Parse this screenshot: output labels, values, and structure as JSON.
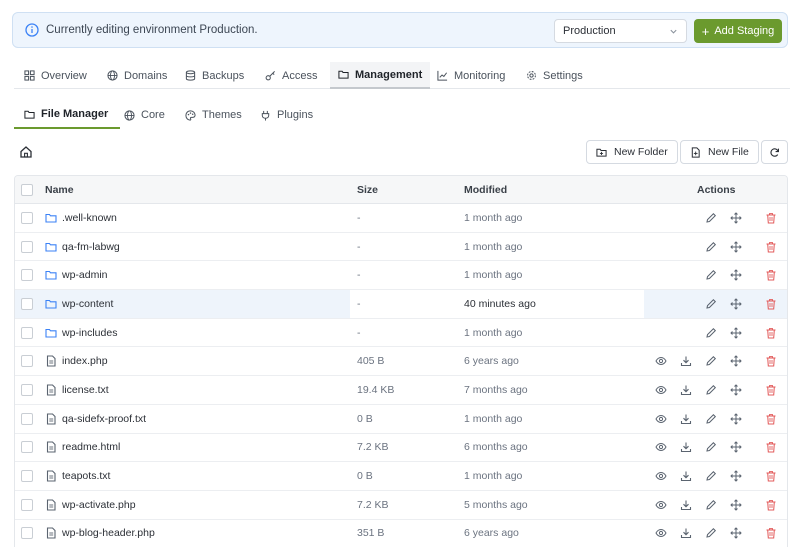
{
  "banner": {
    "text": "Currently editing environment Production.",
    "environment": "Production",
    "add_staging_label": "Add Staging"
  },
  "main_tabs": [
    {
      "label": "Overview",
      "icon": "grid-icon"
    },
    {
      "label": "Domains",
      "icon": "globe-icon"
    },
    {
      "label": "Backups",
      "icon": "database-icon"
    },
    {
      "label": "Access",
      "icon": "key-icon"
    },
    {
      "label": "Management",
      "icon": "folder-icon",
      "active": true
    },
    {
      "label": "Monitoring",
      "icon": "chart-icon"
    },
    {
      "label": "Settings",
      "icon": "gear-icon"
    }
  ],
  "sub_tabs": [
    {
      "label": "File Manager",
      "icon": "folder-icon",
      "active": true
    },
    {
      "label": "Core",
      "icon": "globe-icon"
    },
    {
      "label": "Themes",
      "icon": "palette-icon"
    },
    {
      "label": "Plugins",
      "icon": "plug-icon"
    }
  ],
  "toolbar": {
    "new_folder_label": "New Folder",
    "new_file_label": "New File"
  },
  "table": {
    "headers": {
      "name": "Name",
      "size": "Size",
      "modified": "Modified",
      "actions": "Actions"
    },
    "rows": [
      {
        "name": ".well-known",
        "type": "folder",
        "size": "-",
        "modified": "1 month ago"
      },
      {
        "name": "qa-fm-labwg",
        "type": "folder",
        "size": "-",
        "modified": "1 month ago"
      },
      {
        "name": "wp-admin",
        "type": "folder",
        "size": "-",
        "modified": "1 month ago"
      },
      {
        "name": "wp-content",
        "type": "folder",
        "size": "-",
        "modified": "40 minutes ago",
        "highlight": true
      },
      {
        "name": "wp-includes",
        "type": "folder",
        "size": "-",
        "modified": "1 month ago"
      },
      {
        "name": "index.php",
        "type": "file",
        "size": "405 B",
        "modified": "6 years ago"
      },
      {
        "name": "license.txt",
        "type": "file",
        "size": "19.4 KB",
        "modified": "7 months ago"
      },
      {
        "name": "qa-sidefx-proof.txt",
        "type": "file",
        "size": "0 B",
        "modified": "1 month ago"
      },
      {
        "name": "readme.html",
        "type": "file",
        "size": "7.2 KB",
        "modified": "6 months ago"
      },
      {
        "name": "teapots.txt",
        "type": "file",
        "size": "0 B",
        "modified": "1 month ago"
      },
      {
        "name": "wp-activate.php",
        "type": "file",
        "size": "7.2 KB",
        "modified": "5 months ago"
      },
      {
        "name": "wp-blog-header.php",
        "type": "file",
        "size": "351 B",
        "modified": "6 years ago"
      }
    ]
  },
  "colors": {
    "accent": "#6b9a2e",
    "folder": "#3b82f6",
    "delete": "#e35d5d",
    "banner_bg": "#eef5fd",
    "highlight": "#eef4fb"
  }
}
